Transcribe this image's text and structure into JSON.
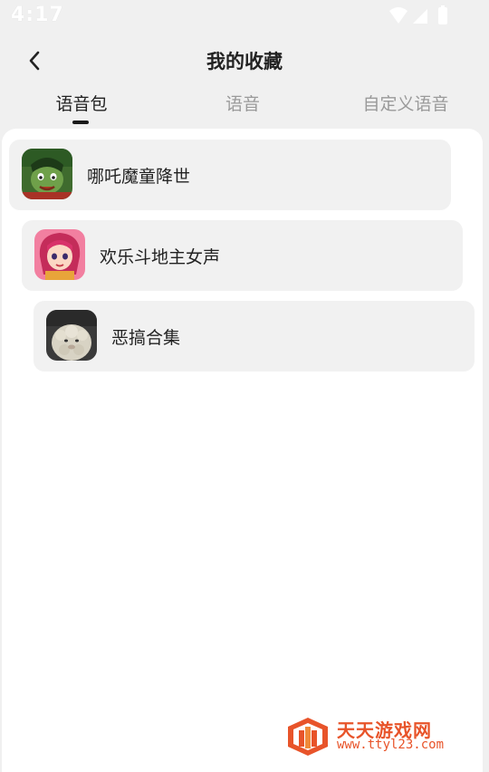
{
  "status_bar": {
    "time": "4:17",
    "icons": [
      "wifi-icon",
      "signal-icon",
      "battery-icon"
    ]
  },
  "header": {
    "title": "我的收藏",
    "back_icon": "chevron-left-icon"
  },
  "tabs": [
    {
      "label": "语音包",
      "active": true
    },
    {
      "label": "语音",
      "active": false
    },
    {
      "label": "自定义语音",
      "active": false
    }
  ],
  "favorites": [
    {
      "label": "哪吒魔童降世",
      "icon": "nezha-avatar"
    },
    {
      "label": "欢乐斗地主女声",
      "icon": "doudizhu-girl-avatar"
    },
    {
      "label": "恶搞合集",
      "icon": "sheep-avatar"
    }
  ],
  "watermark": {
    "title": "天天游戏网",
    "url": "www.ttyl23.com",
    "color": "#e8542a"
  }
}
